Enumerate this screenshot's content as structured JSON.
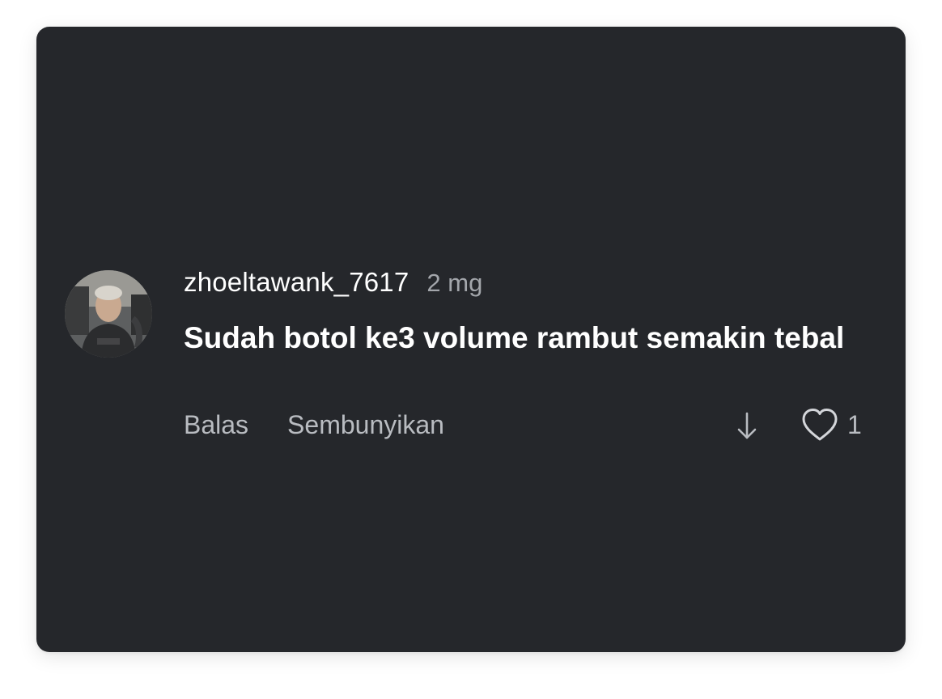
{
  "comment": {
    "username": "zhoeltawank_7617",
    "time": "2 mg",
    "text": "Sudah botol ke3 volume rambut semakin tebal",
    "actions": {
      "reply_label": "Balas",
      "hide_label": "Sembunyikan"
    },
    "likes": "1",
    "icons": {
      "avatar": "user-avatar-photo",
      "dislike": "arrow-down-icon",
      "like": "heart-outline-icon"
    }
  },
  "colors": {
    "card_background": "#25272b",
    "primary_text": "#ffffff",
    "secondary_text": "#a3a6ab",
    "action_text": "#b9bcc1"
  }
}
